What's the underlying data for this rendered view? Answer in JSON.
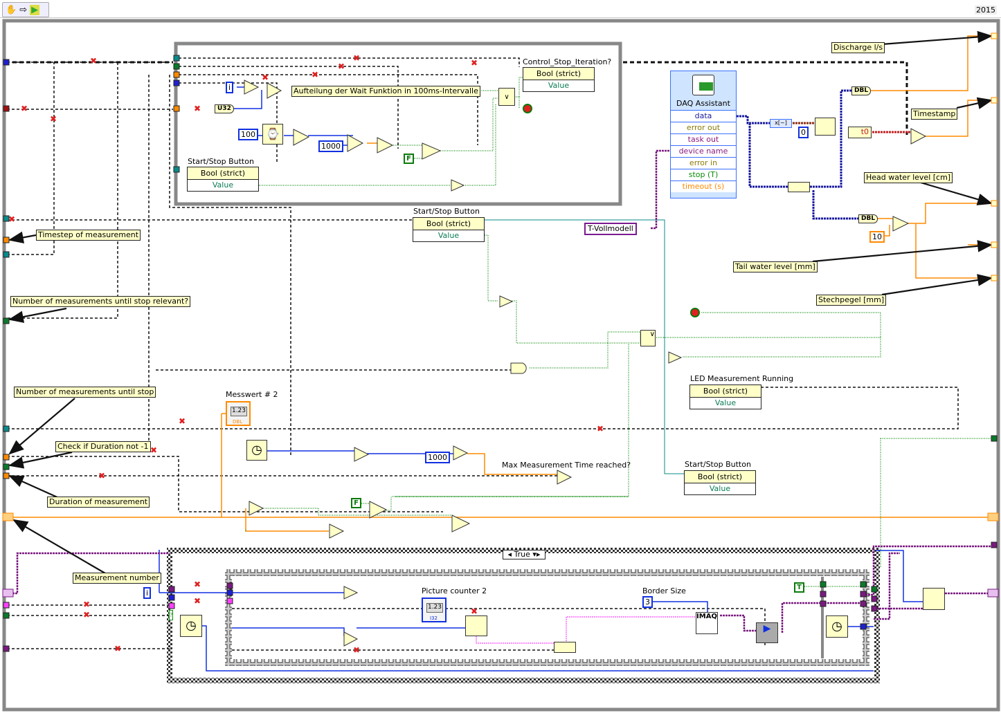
{
  "toolbar": {
    "icons": [
      "hand-icon",
      "arrow-icon",
      "run-icon"
    ],
    "version": "2015"
  },
  "inner_loop": {
    "free_label": "Aufteilung der Wait Funktion in 100ms-Intervalle",
    "control_stop": {
      "label": "Control_Stop_Iteration?",
      "type": "Bool (strict)",
      "property": "Value"
    },
    "start_stop": {
      "label": "Start/Stop Button",
      "type": "Bool (strict)",
      "property": "Value"
    },
    "const_100": "100",
    "const_1000": "1000",
    "const_false": "F",
    "iter": "i",
    "u32": "U32"
  },
  "daq": {
    "title": "DAQ Assistant",
    "terminals": [
      {
        "label": "data",
        "color": "#1a1aa0"
      },
      {
        "label": "error out",
        "color": "#8a7a00"
      },
      {
        "label": "task out",
        "color": "#8a1a80"
      },
      {
        "label": "device name",
        "color": "#8a1a80"
      },
      {
        "label": "error in",
        "color": "#8a7a00"
      },
      {
        "label": "stop (T)",
        "color": "#0a8a0a"
      },
      {
        "label": "timeout (s)",
        "color": "#ff8a00"
      }
    ]
  },
  "right": {
    "dbl1": "DBL",
    "dbl2": "DBL",
    "const_0": "0",
    "t0": "t0",
    "const_10": "10"
  },
  "labels": {
    "discharge": "Discharge l/s",
    "timestamp": "Timestamp",
    "head": "Head water level [cm]",
    "tail": "Tail water level [mm]",
    "stechpegel": "Stechpegel [mm]",
    "timestep": "Timestep of measurement",
    "n_relevant": "Number of measurements until stop relevant?",
    "n_stop": "Number of measurements until stop",
    "check_dur": "Check if Duration not -1",
    "duration": "Duration of measurement",
    "meas_num": "Measurement number"
  },
  "middle": {
    "start_stop2": {
      "label": "Start/Stop Button",
      "type": "Bool (strict)",
      "property": "Value"
    },
    "ring": "T-Vollmodell",
    "led": {
      "label": "LED Measurement Running",
      "type": "Bool (strict)",
      "property": "Value"
    },
    "start_stop3": {
      "label": "Start/Stop Button",
      "type": "Bool (strict)",
      "property": "Value"
    },
    "messwert": "Messwert # 2",
    "messwert_type": "DBL",
    "max_time": "Max Measurement Time reached?",
    "const_1000": "1000",
    "const_false": "F",
    "ind_val": "1.23"
  },
  "case": {
    "selector": "True",
    "picture_counter": "Picture counter 2",
    "picture_type": "I32",
    "border_size": "Border Size",
    "const_3": "3",
    "const_true": "T",
    "imaq": "IMAQ",
    "iter": "i",
    "q": "?"
  },
  "colors": {
    "orange": "#ff8a00",
    "blue": "#1030e0",
    "green": "#0a8a0a",
    "purple": "#7a1a80",
    "pink": "#ff40ff",
    "gray_frame": "#808080"
  }
}
